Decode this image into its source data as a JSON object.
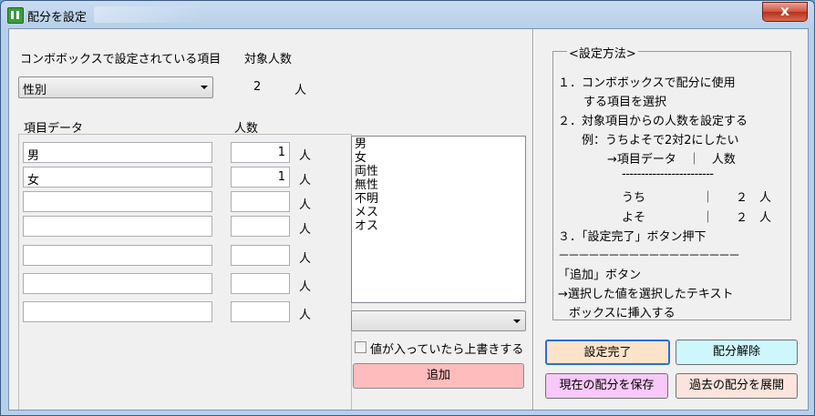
{
  "window": {
    "title": "配分を設定",
    "close_label": "x"
  },
  "left": {
    "combo_header": "コンボボックスで設定されている項目",
    "count_header": "対象人数",
    "combo_value": "性別",
    "target_count": "2",
    "target_unit": "人",
    "item_data_header": "項目データ",
    "people_header": "人数",
    "rows": [
      {
        "item": "男",
        "count": "1",
        "unit": "人"
      },
      {
        "item": "女",
        "count": "1",
        "unit": "人"
      },
      {
        "item": "",
        "count": "",
        "unit": "人"
      },
      {
        "item": "",
        "count": "",
        "unit": "人"
      },
      {
        "item": "",
        "count": "",
        "unit": "人"
      },
      {
        "item": "",
        "count": "",
        "unit": "人"
      },
      {
        "item": "",
        "count": "",
        "unit": "人"
      }
    ]
  },
  "middle": {
    "list_items": [
      "男",
      "女",
      "両性",
      "無性",
      "不明",
      "メス",
      "オス"
    ],
    "combo_value": "",
    "overwrite_label": "値が入っていたら上書きする",
    "overwrite_checked": false,
    "add_button": "追加"
  },
  "guide": {
    "title": "<設定方法>",
    "lines": [
      "１．コンボボックスで配分に使用",
      "する項目を選択",
      "２．対象項目からの人数を設定する",
      "例：うちよそで2対2にしたい",
      "→項目データ　｜　人数",
      "------------------------",
      "うち",
      "｜",
      "２　人",
      "よそ",
      "｜",
      "２　人",
      "３．「設定完了」ボタン押下",
      "－－－－－－－－－－－－－－－－－－",
      "「追加」ボタン",
      "→選択した値を選択したテキスト",
      "ボックスに挿入する"
    ]
  },
  "buttons": {
    "complete": "設定完了",
    "release": "配分解除",
    "save": "現在の配分を保存",
    "expand": "過去の配分を展開"
  },
  "colors": {
    "complete_bg": "#fde3c9",
    "release_bg": "#cdf7fb",
    "save_bg": "#f8c8f8",
    "expand_bg": "#fbe3de",
    "add_bg": "#ffbcbc"
  }
}
